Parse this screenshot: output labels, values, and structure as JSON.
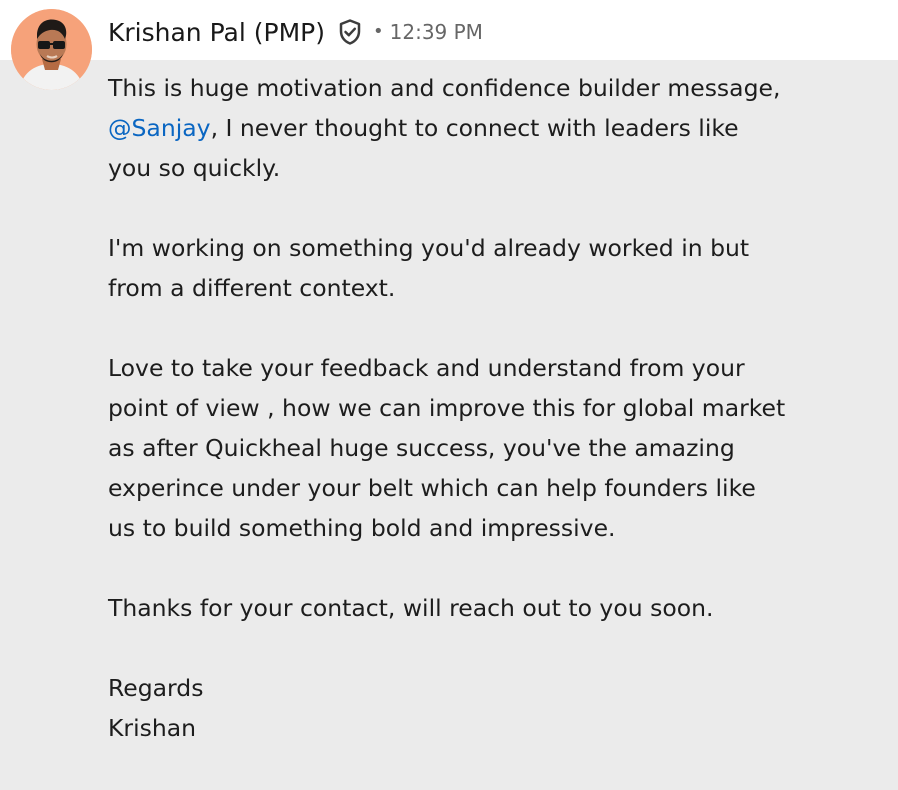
{
  "sender": {
    "name": "Krishan Pal (PMP)",
    "verified_icon": "shield-check-icon",
    "separator": "•",
    "time": "12:39 PM",
    "avatar_icon": "profile-photo"
  },
  "message": {
    "paragraph_1": {
      "before": "This is huge motivation and confidence builder message, ",
      "mention": "@Sanjay",
      "after": ", I never thought to connect with leaders like you so quickly."
    },
    "paragraph_2": "I'm working on something you'd already worked in but from a different context.",
    "paragraph_3": "Love to take your feedback and understand from your point of view , how we can improve this for global market as after Quickheal huge success, you've the amazing experince under your belt which can help founders like us to build something bold and impressive.",
    "paragraph_4": "Thanks for your contact, will reach out to you soon.",
    "signoff": "Regards\nKrishan"
  },
  "colors": {
    "mention": "#0a66c2",
    "message_background": "#ebebeb",
    "text": "#1d1d1d",
    "meta": "#666666"
  }
}
